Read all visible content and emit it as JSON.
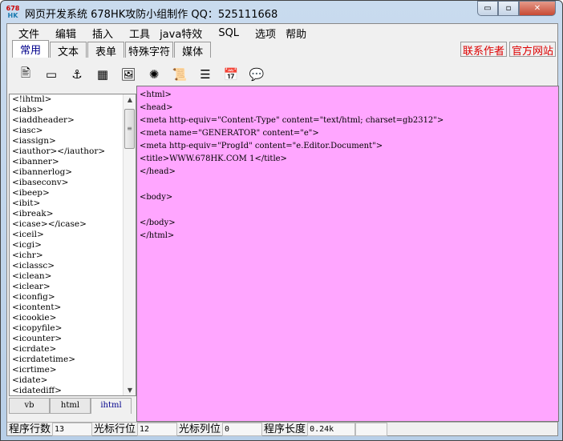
{
  "window": {
    "title": "网页开发系统 678HK攻防小组制作 QQ：525111668",
    "logo_top": "678",
    "logo_bottom": "HK",
    "minimize": "▭",
    "maximize": "▫",
    "close": "✕"
  },
  "menu": [
    "文件",
    "编辑",
    "插入",
    "工具",
    "java特效",
    "SQL",
    "选项",
    "帮助"
  ],
  "tabs": [
    {
      "label": "常用",
      "active": true
    },
    {
      "label": "文本"
    },
    {
      "label": "表单"
    },
    {
      "label": "特殊字符"
    },
    {
      "label": "媒体"
    }
  ],
  "links": [
    "联系作者",
    "官方网站"
  ],
  "toolbar": [
    {
      "name": "document-icon",
      "glyph": "🖹"
    },
    {
      "name": "form-icon",
      "glyph": "▭"
    },
    {
      "name": "anchor-icon",
      "glyph": "⚓"
    },
    {
      "name": "table-icon",
      "glyph": "▦"
    },
    {
      "name": "image-icon",
      "glyph": "🖼"
    },
    {
      "name": "flash-icon",
      "glyph": "✺"
    },
    {
      "name": "scroll-icon",
      "glyph": "📜"
    },
    {
      "name": "horizontal-rule-icon",
      "glyph": "☰"
    },
    {
      "name": "calendar-icon",
      "glyph": "📅"
    },
    {
      "name": "comment-icon",
      "glyph": "💬"
    }
  ],
  "tag_list": [
    "<!ihtml>",
    "<iabs>",
    "<iaddheader>",
    "<iasc>",
    "<iassign>",
    "<iauthor></iauthor>",
    "<ibanner>",
    "<ibannerlog>",
    "<ibaseconv>",
    "<ibeep>",
    "<ibit>",
    "<ibreak>",
    "<icase></icase>",
    "<iceil>",
    "<icgi>",
    "<ichr>",
    "<iclassc>",
    "<iclean>",
    "<iclear>",
    "<iconfig>",
    "<icontent>",
    "<icookie>",
    "<icopyfile>",
    "<icounter>",
    "<icrdate>",
    "<icrdatetime>",
    "<icrtime>",
    "<idate>",
    "<idatediff>"
  ],
  "bottom_tabs": [
    {
      "label": "vb"
    },
    {
      "label": "html"
    },
    {
      "label": "ihtml",
      "active": true
    }
  ],
  "editor": {
    "bg": "#ffa6ff",
    "content": "<html>\n<head>\n<meta http-equiv=\"Content-Type\" content=\"text/html; charset=gb2312\">\n<meta name=\"GENERATOR\" content=\"e\">\n<meta http-equiv=\"ProgId\" content=\"e.Editor.Document\">\n<title>WWW.678HK.COM 1</title>\n</head>\n\n<body>\n\n</body>\n</html>"
  },
  "status": {
    "lines_label": "程序行数",
    "lines": "13",
    "row_label": "光标行位",
    "row": "12",
    "col_label": "光标列位",
    "col": "0",
    "len_label": "程序长度",
    "len": "0.24k"
  }
}
